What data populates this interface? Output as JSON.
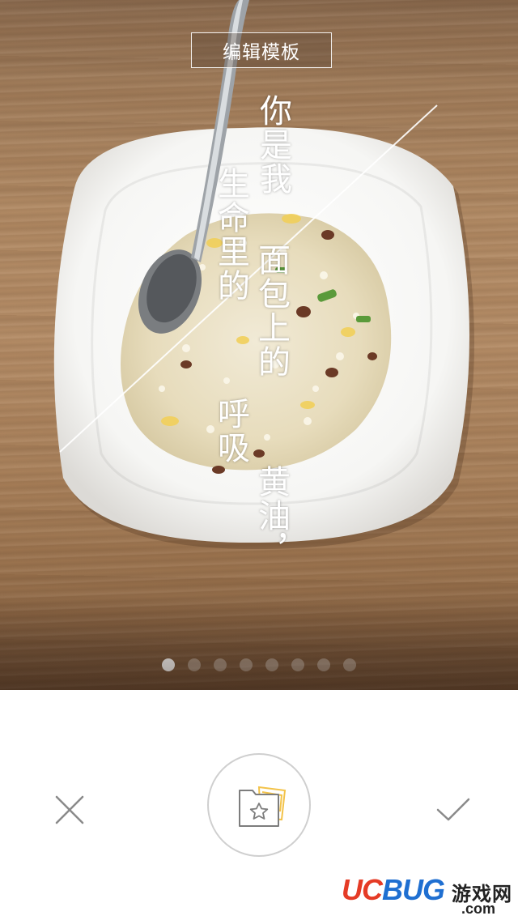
{
  "header": {
    "edit_template_label": "编辑模板"
  },
  "poem": {
    "col1": "你是我",
    "col2": "面包上的",
    "col3": "生命里的",
    "col4": "呼吸",
    "col5": "黄油，"
  },
  "pager": {
    "total": 8,
    "active_index": 0
  },
  "controls": {
    "close_icon": "close-icon",
    "favorite_icon": "folder-star-icon",
    "confirm_icon": "checkmark-icon"
  },
  "watermark": {
    "uc": "UC",
    "bug": "BUG",
    "cn": "游戏网",
    "com": ".com"
  },
  "colors": {
    "accent_yellow": "#f3c34a",
    "icon_gray": "#8a8a8a",
    "wm_red": "#e53b26",
    "wm_blue": "#1f6fd1"
  }
}
